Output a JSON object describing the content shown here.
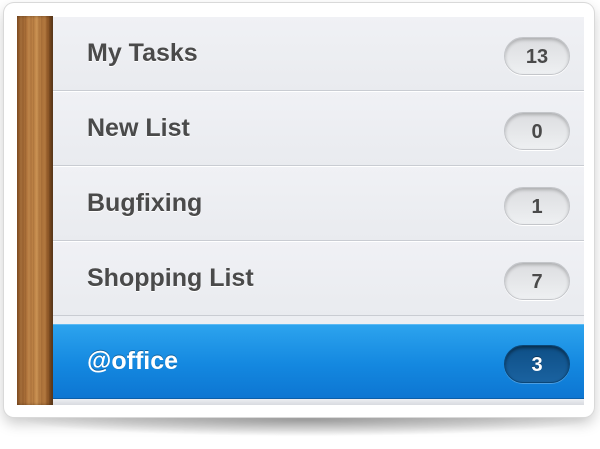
{
  "lists": [
    {
      "name": "My Tasks",
      "count": "13"
    },
    {
      "name": "New List",
      "count": "0"
    },
    {
      "name": "Bugfixing",
      "count": "1"
    },
    {
      "name": "Shopping List",
      "count": "7"
    },
    {
      "name": "@office",
      "count": "3",
      "selected": true
    }
  ],
  "colors": {
    "selected_row": "#1488e0",
    "selected_badge": "#0e4f86",
    "row_background": "#eceef2",
    "label_text": "#4a4a4a"
  },
  "icons": {
    "sidebar_texture": "wood-texture"
  }
}
